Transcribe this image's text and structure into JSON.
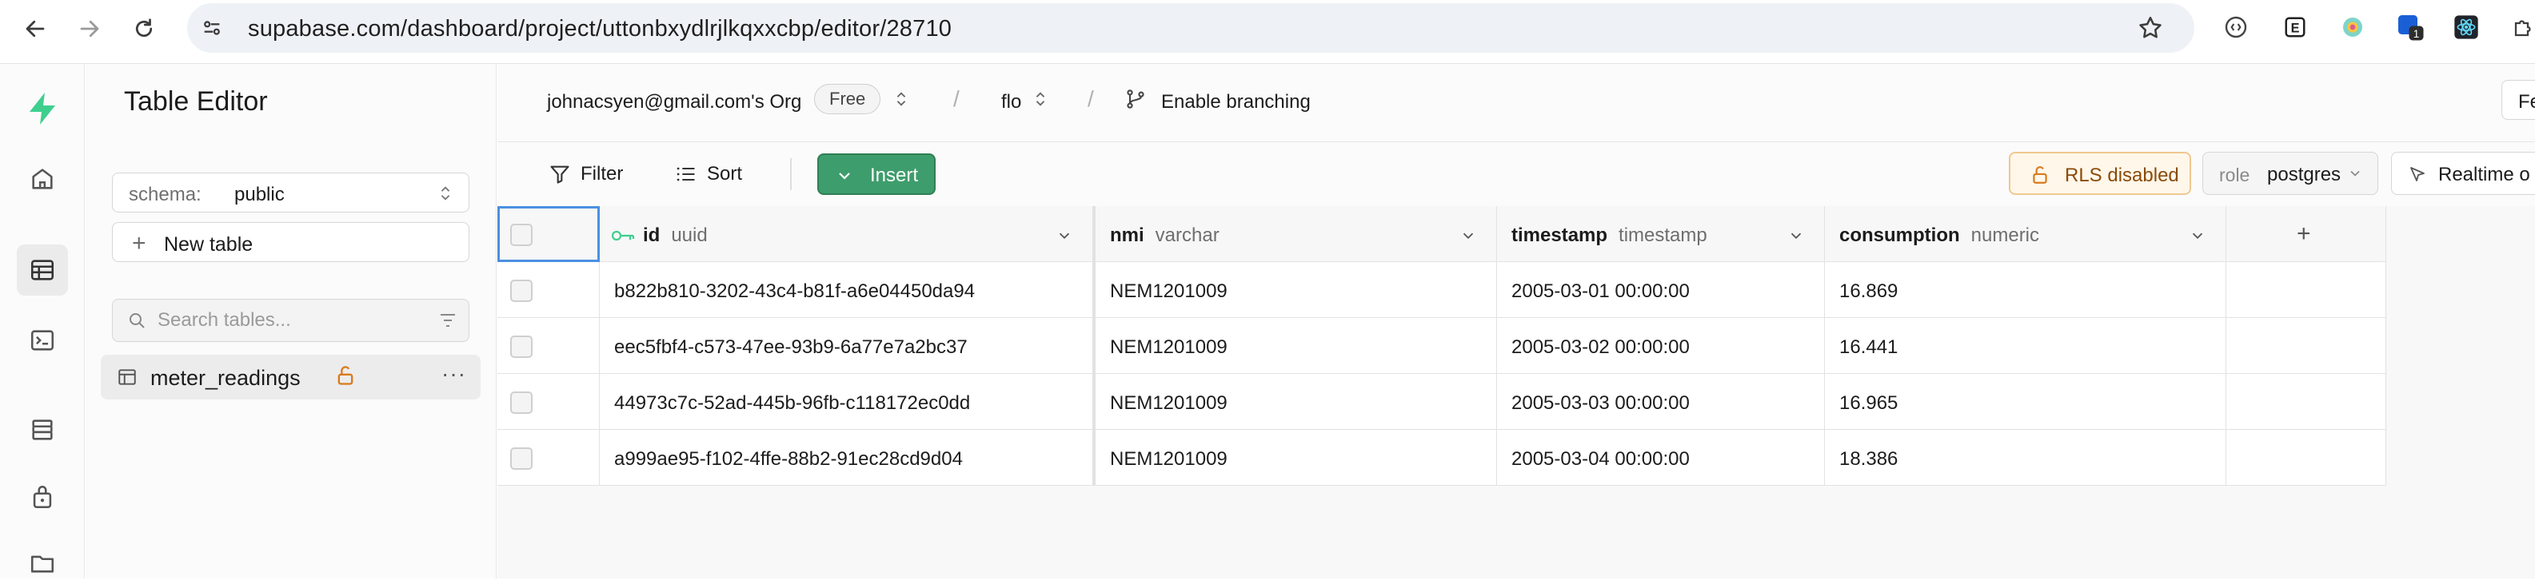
{
  "browser": {
    "url": "supabase.com/dashboard/project/uttonbxydlrjlkqxxcbp/editor/28710",
    "extension_badge": "1",
    "extension_letter": "E"
  },
  "sidebar": {
    "title": "Table Editor",
    "schema_label": "schema:",
    "schema_value": "public",
    "new_table_label": "New table",
    "search_placeholder": "Search tables...",
    "tables": [
      {
        "name": "meter_readings"
      }
    ]
  },
  "header": {
    "org": "johnacsyen@gmail.com's Org",
    "plan": "Free",
    "separator": "/",
    "project": "flo",
    "branching": "Enable branching",
    "right_button_partial": "Fe"
  },
  "toolbar": {
    "filter": "Filter",
    "sort": "Sort",
    "insert": "Insert",
    "rls": "RLS disabled",
    "role_label": "role",
    "role_value": "postgres",
    "realtime": "Realtime o"
  },
  "grid": {
    "columns": [
      {
        "name": "id",
        "type": "uuid"
      },
      {
        "name": "nmi",
        "type": "varchar"
      },
      {
        "name": "timestamp",
        "type": "timestamp"
      },
      {
        "name": "consumption",
        "type": "numeric"
      }
    ],
    "add_column": "+",
    "rows": [
      [
        "b822b810-3202-43c4-b81f-a6e04450da94",
        "NEM1201009",
        "2005-03-01 00:00:00",
        "16.869"
      ],
      [
        "eec5fbf4-c573-47ee-93b9-6a77e7a2bc37",
        "NEM1201009",
        "2005-03-02 00:00:00",
        "16.441"
      ],
      [
        "44973c7c-52ad-445b-96fb-c118172ec0dd",
        "NEM1201009",
        "2005-03-03 00:00:00",
        "16.965"
      ],
      [
        "a999ae95-f102-4ffe-88b2-91ec28cd9d04",
        "NEM1201009",
        "2005-03-04 00:00:00",
        "18.386"
      ]
    ]
  },
  "colors": {
    "brand_green": "#3ecf8e",
    "insert_green": "#3e9d6c",
    "rls_orange": "#d97a1c",
    "selection_blue": "#4a90e2"
  }
}
